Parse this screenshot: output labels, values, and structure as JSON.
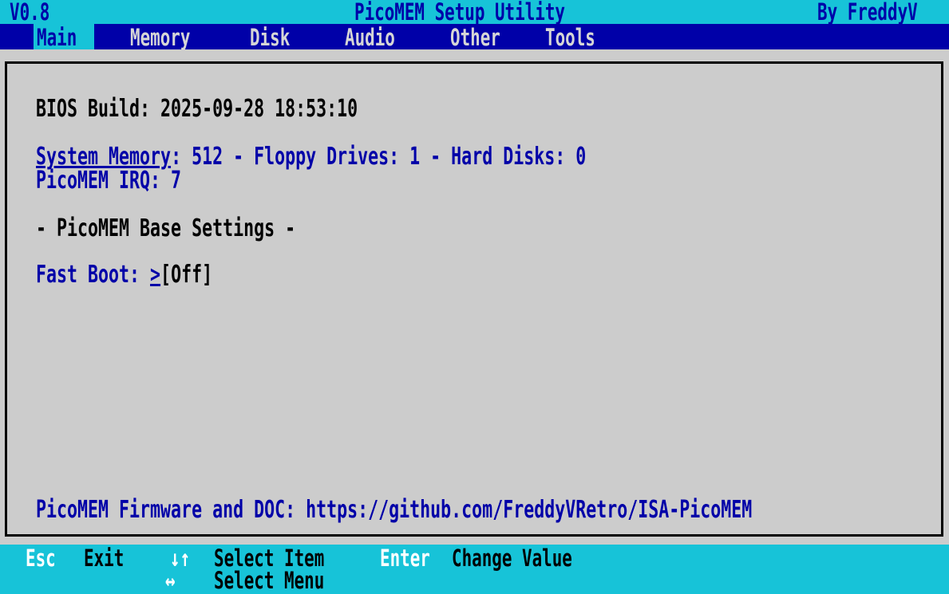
{
  "header": {
    "version": "V0.8",
    "title": "PicoMEM Setup Utility",
    "author": "By FreddyV"
  },
  "menu": {
    "items": [
      {
        "label": "Main",
        "active": true
      },
      {
        "label": "Memory",
        "active": false
      },
      {
        "label": "Disk",
        "active": false
      },
      {
        "label": "Audio",
        "active": false
      },
      {
        "label": "Other",
        "active": false
      },
      {
        "label": "Tools",
        "active": false
      }
    ]
  },
  "main": {
    "bios_build": "BIOS Build: 2025-09-28 18:53:10",
    "system_memory_label": "System Memory",
    "system_memory_rest": ": 512 - Floppy Drives: 1 - Hard Disks: 0",
    "irq": "PicoMEM IRQ: 7",
    "base_settings_heading": "- PicoMEM Base Settings -",
    "fast_boot_label": "Fast Boot: ",
    "fast_boot_cursor": ">",
    "fast_boot_value": "[Off]",
    "footer": "PicoMEM Firmware and DOC: https://github.com/FreddyVRetro/ISA-PicoMEM"
  },
  "help": {
    "esc_key": "Esc",
    "esc_desc": "Exit",
    "updown_icon": "up-down-arrows-icon",
    "updown_glyph": "↓↑",
    "updown_desc": "Select Item",
    "enter_key": "Enter",
    "enter_desc": "Change Value",
    "leftright_icon": "left-right-arrow-icon",
    "leftright_glyph": "↔",
    "leftright_desc": "Select Menu"
  },
  "colors": {
    "title_bar_bg": "#17c3d8",
    "menu_bar_bg": "#0000a8",
    "panel_bg": "#cccccc",
    "text_blue": "#0000a8",
    "key_white": "#ffffff"
  }
}
